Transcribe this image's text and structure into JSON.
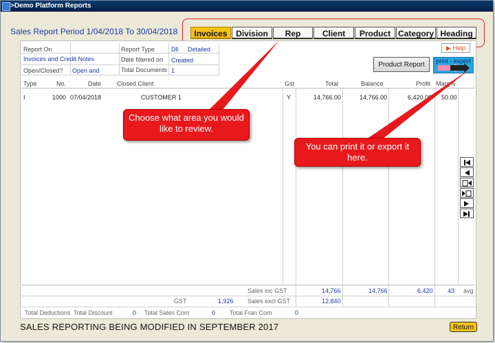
{
  "window": {
    "title": ">Demo Platform Reports"
  },
  "header": {
    "period": "Sales Report Period  1/04/2018 To 30/04/2018"
  },
  "tabs": [
    {
      "label": "Invoices",
      "active": true
    },
    {
      "label": "Division"
    },
    {
      "label": "Rep"
    },
    {
      "label": "Client"
    },
    {
      "label": "Product"
    },
    {
      "label": "Category"
    },
    {
      "label": "Heading"
    }
  ],
  "filters": {
    "report_on_label": "Report On",
    "report_on_value": "Invoices and Credit Notes",
    "open_closed_label": "Open/Closed?",
    "open_closed_value": "Open and",
    "report_type_label": "Report Type",
    "report_type_value1": "Dll",
    "report_type_value2": "Detailed",
    "date_filter_label": "Date filtered on",
    "date_filter_value": "Created",
    "total_docs_label": "Total Documents",
    "total_docs_value": "1"
  },
  "buttons": {
    "help": "▶ Help",
    "product_report": "Product Report",
    "print_export": "print - export",
    "return": "Return"
  },
  "table": {
    "headers": [
      "Type",
      "No.",
      "Date",
      "Closed Client",
      "Gst",
      "Total",
      "Balance",
      "Profit",
      "Marg%"
    ],
    "rows": [
      [
        "I",
        "1000",
        "07/04/2018",
        "CUSTOMER 1",
        "Y",
        "14,766.00",
        "14,766.00",
        "6,420.00",
        "50.00"
      ]
    ]
  },
  "footer": {
    "sales_inc_gst_label": "Sales inc GST",
    "sales_inc_total": "14,766",
    "sales_inc_balance": "14,766",
    "sales_inc_profit": "6,420",
    "sales_inc_marg": "43",
    "avg_label": "avg",
    "gst_label": "GST",
    "gst_value": "1,926",
    "sales_excl_gst_label": "Sales excl GST",
    "sales_excl_total": "12,840",
    "total_deductions_label": "Total Deductions",
    "total_discount_label": "Total Discount",
    "total_discount_value": "0",
    "total_sales_com_label": "Total Sales Com",
    "total_sales_com_value": "0",
    "total_fran_com_label": "Total Fran Com",
    "total_fran_com_value": "0"
  },
  "banner": "SALES REPORTING BEING MODIFIED IN SEPTEMBER 2017",
  "callouts": {
    "tabs": "Choose what area you would like to review.",
    "export": "You can print it or export it here."
  },
  "colors": {
    "accent_tab": "#f5c21a",
    "callout": "#e8191c",
    "link_blue": "#1a3aa8"
  }
}
